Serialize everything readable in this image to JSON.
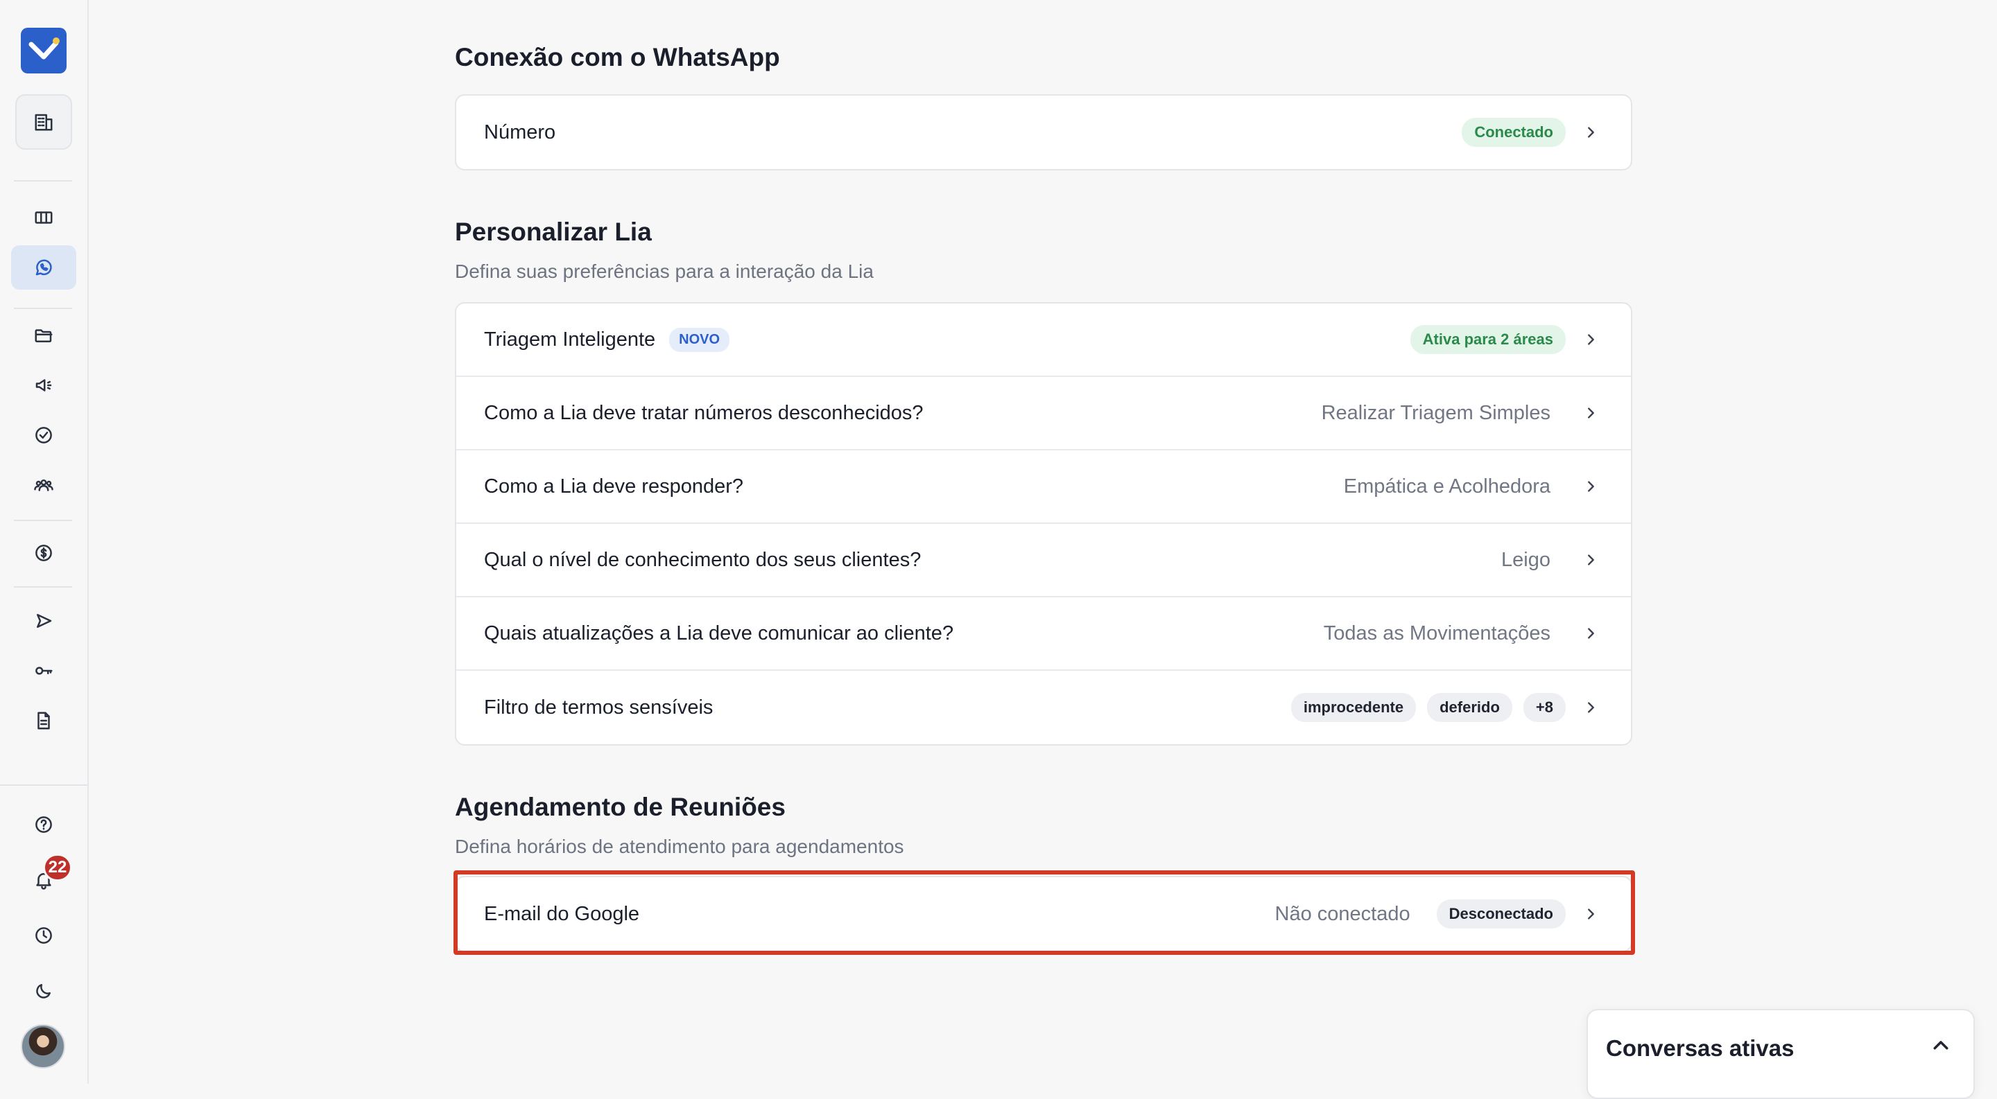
{
  "colors": {
    "brand": "#2b5fc9",
    "success": "#2a8a4a",
    "highlight": "#d23a26",
    "badge": "#c0302b"
  },
  "sidebar": {
    "items": [
      {
        "icon": "building-icon"
      },
      {
        "icon": "columns-icon"
      },
      {
        "icon": "whatsapp-icon",
        "active": true
      },
      {
        "icon": "folder-icon"
      },
      {
        "icon": "megaphone-icon"
      },
      {
        "icon": "check-circle-icon"
      },
      {
        "icon": "users-icon"
      },
      {
        "icon": "dollar-circle-icon"
      },
      {
        "icon": "send-icon"
      },
      {
        "icon": "key-icon"
      },
      {
        "icon": "document-icon"
      },
      {
        "icon": "help-icon"
      },
      {
        "icon": "bell-icon"
      },
      {
        "icon": "clock-icon"
      },
      {
        "icon": "moon-icon"
      }
    ],
    "notification_count": "22"
  },
  "whatsapp": {
    "title": "Conexão com o WhatsApp",
    "number_label": "Número",
    "number_status": "Conectado"
  },
  "lia": {
    "title": "Personalizar Lia",
    "subtitle": "Defina suas preferências para a interação da Lia",
    "rows": [
      {
        "label": "Triagem Inteligente",
        "badge": "NOVO",
        "status": "Ativa para 2 áreas"
      },
      {
        "label": "Como a Lia deve tratar números desconhecidos?",
        "value": "Realizar Triagem Simples"
      },
      {
        "label": "Como a Lia deve responder?",
        "value": "Empática e Acolhedora"
      },
      {
        "label": "Qual o nível de conhecimento dos seus clientes?",
        "value": "Leigo"
      },
      {
        "label": "Quais atualizações a Lia deve comunicar ao cliente?",
        "value": "Todas as Movimentações"
      },
      {
        "label": "Filtro de termos sensíveis",
        "tags": [
          "improcedente",
          "deferido",
          "+8"
        ]
      }
    ]
  },
  "meetings": {
    "title": "Agendamento de Reuniões",
    "subtitle": "Defina horários de atendimento para agendamentos",
    "google_label": "E-mail do Google",
    "google_value": "Não conectado",
    "google_status": "Desconectado"
  },
  "active_chats": {
    "title": "Conversas ativas"
  }
}
